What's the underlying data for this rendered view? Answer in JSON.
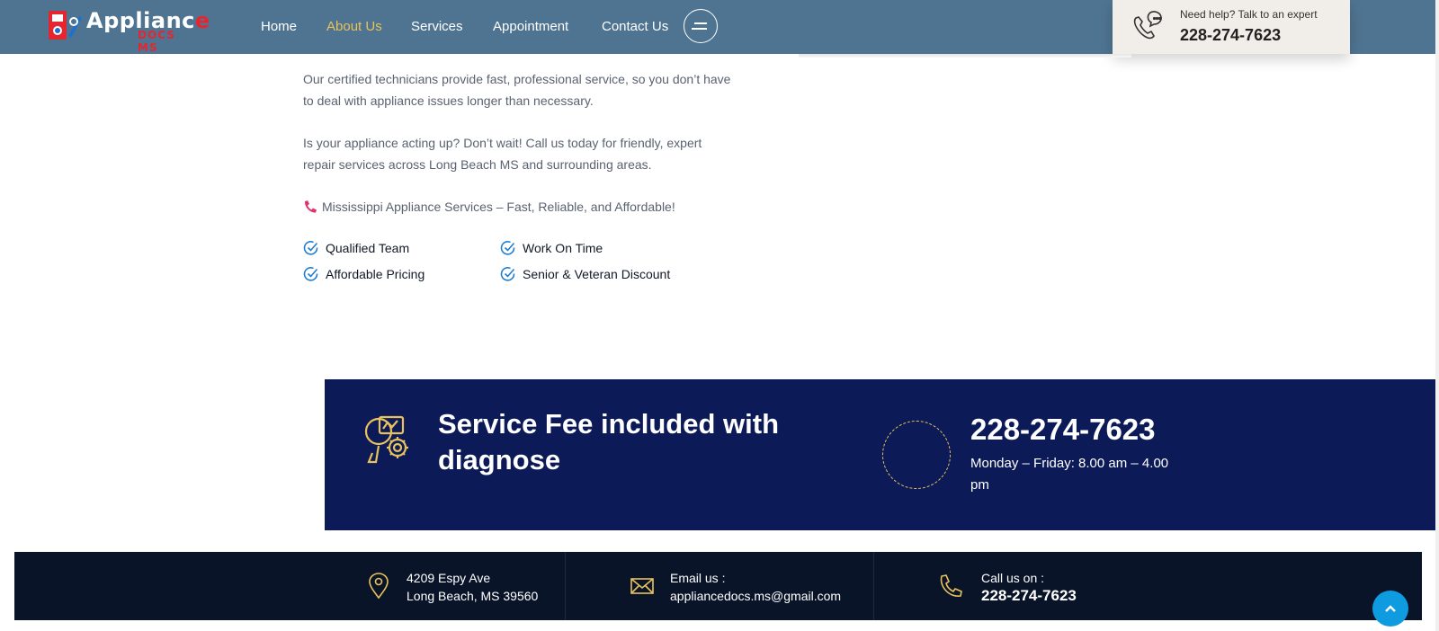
{
  "header": {
    "logo": {
      "main": "Applianc",
      "accent": "e",
      "sub": "DOCS MS"
    },
    "nav": [
      {
        "label": "Home",
        "active": false
      },
      {
        "label": "About Us",
        "active": true
      },
      {
        "label": "Services",
        "active": false
      },
      {
        "label": "Appointment",
        "active": false
      },
      {
        "label": "Contact Us",
        "active": false
      }
    ],
    "menu_icon": "hamburger-icon",
    "help": {
      "text": "Need help? Talk to an expert",
      "phone": "228-274-7623",
      "icon": "phone-chat-icon"
    }
  },
  "content": {
    "para1": "Our certified technicians provide fast, professional service, so you don’t have to deal with appliance issues longer than necessary.",
    "para2": "Is your appliance acting up? Don’t wait! Call us today for friendly, expert repair services across Long Beach MS and surrounding areas.",
    "tagline": "Mississippi Appliance Services – Fast, Reliable, and Affordable!",
    "features": [
      "Qualified Team",
      "Work On Time",
      "Affordable Pricing",
      "Senior & Veteran Discount"
    ]
  },
  "banner": {
    "title": "Service Fee included with diagnose",
    "phone": "228-274-7623",
    "hours": "Monday – Friday: 8.00 am – 4.00 pm"
  },
  "footer": {
    "address_line1": "4209 Espy Ave",
    "address_line2": "Long Beach, MS 39560",
    "email_label": "Email us :",
    "email": "appliancedocs.ms@gmail.com",
    "call_label": "Call us on :",
    "call_phone": "228-274-7623"
  },
  "colors": {
    "header_bg": "#4f7491",
    "nav_active": "#e8c25c",
    "banner_bg": "#0d1a58",
    "footer_bg": "#0a1429",
    "accent_gold": "#e8c25c",
    "check_blue": "#1e7fd1",
    "scroll_top": "#0e9be0"
  }
}
